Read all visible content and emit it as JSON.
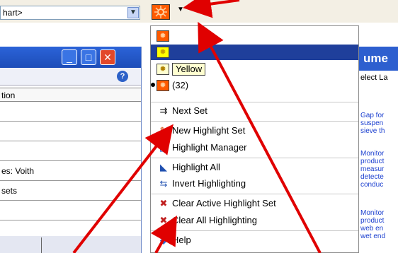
{
  "toolbar": {
    "combo_text": "hart>",
    "highlight_button_icon": "highlight-sun-icon",
    "colors": {
      "accent": "#1f3f9b",
      "highlight_orange": "#ff5a00",
      "highlight_yellow": "#ffff00",
      "arrow": "#e00000"
    }
  },
  "left_window": {
    "help_label": "?",
    "column_header": "tion",
    "rows": [
      "",
      "",
      "",
      "es: Voith",
      "sets",
      ""
    ],
    "window_buttons": [
      "_",
      "□",
      "✕"
    ]
  },
  "right_panel": {
    "title": "ume",
    "subtitle": "elect La",
    "lines": [
      "Gap for",
      "suspen",
      "sieve th",
      "Monitor",
      "product",
      "measur",
      "detecte",
      "conduc",
      "Monitor",
      "product",
      "web en",
      "wet end"
    ]
  },
  "menu": {
    "swatch_orange": "",
    "swatch_yellow_selected": "",
    "yellow_label": "Yellow",
    "current_count": "(32)",
    "items": [
      {
        "label": "Next Set",
        "icon": "next-set-icon"
      },
      {
        "label": "New Highlight Set",
        "icon": "new-highlight-set-icon"
      },
      {
        "label": "Highlight Manager",
        "icon": "highlight-manager-icon"
      },
      {
        "label": "Highlight All",
        "icon": "highlight-all-icon"
      },
      {
        "label": "Invert Highlighting",
        "icon": "invert-highlighting-icon"
      },
      {
        "label": "Clear Active Highlight Set",
        "icon": "clear-active-set-icon"
      },
      {
        "label": "Clear All Highlighting",
        "icon": "clear-all-icon"
      },
      {
        "label": "Help",
        "icon": "help-icon"
      }
    ]
  }
}
